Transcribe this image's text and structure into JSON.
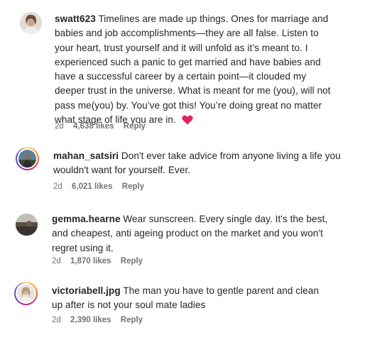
{
  "comments": [
    {
      "username": "swatt623",
      "text": "Timelines are made up things. Ones for marriage and babies and job accomplishments—they are all false. Listen to your heart, trust yourself and it will unfold as it’s meant to. I experienced such a panic to get married and have babies and have a successful career by a certain point—it clouded my deeper trust in the universe. What is meant for me (you), will not pass me(you) by. You’ve got this! You’re doing great no matter what stage of life you are in.",
      "emoji": "heart-emoji",
      "time": "2d",
      "likes": "4,638 likes",
      "reply": "Reply"
    },
    {
      "username": "mahan_satsiri",
      "text": "Don't ever take advice from anyone living a life you wouldn't want for yourself. Ever.",
      "time": "2d",
      "likes": "6,021 likes",
      "reply": "Reply"
    },
    {
      "username": "gemma.hearne",
      "text": "Wear sunscreen. Every single day. It's the best, and cheapest, anti ageing product on the market and you won't regret using it.",
      "time": "2d",
      "likes": "1,870 likes",
      "reply": "Reply"
    },
    {
      "username": "victoriabell.jpg",
      "text": "The man you have to gentle parent and clean up after is not your soul mate ladies",
      "time": "2d",
      "likes": "2,390 likes",
      "reply": "Reply"
    }
  ],
  "colors": {
    "text": "#262626",
    "meta": "#737373",
    "heart": "#e0245e"
  }
}
